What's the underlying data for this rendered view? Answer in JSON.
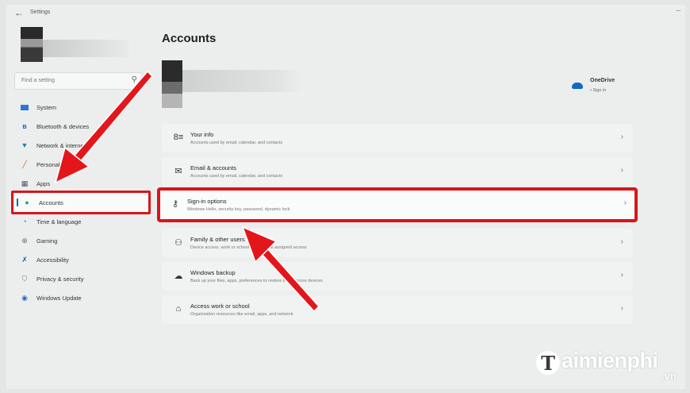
{
  "window": {
    "title": "Settings"
  },
  "sidebar": {
    "search_placeholder": "Find a setting",
    "items": [
      {
        "label": "System",
        "icon": "monitor-icon",
        "color": "#2b78d5"
      },
      {
        "label": "Bluetooth & devices",
        "icon": "bluetooth-icon",
        "color": "#1d6fcb"
      },
      {
        "label": "Network & internet",
        "icon": "wifi-icon",
        "color": "#1d7fb5"
      },
      {
        "label": "Personalization",
        "icon": "brush-icon",
        "color": "#c56a2d"
      },
      {
        "label": "Apps",
        "icon": "apps-icon",
        "color": "#4a5670"
      },
      {
        "label": "Accounts",
        "icon": "person-icon",
        "color": "#2ea66a",
        "active": true
      },
      {
        "label": "Time & language",
        "icon": "globe-clock-icon",
        "color": "#2e7cc4"
      },
      {
        "label": "Gaming",
        "icon": "gamepad-icon",
        "color": "#6d6d6d"
      },
      {
        "label": "Accessibility",
        "icon": "accessibility-icon",
        "color": "#1e5fab"
      },
      {
        "label": "Privacy & security",
        "icon": "shield-icon",
        "color": "#7b7b7b"
      },
      {
        "label": "Windows Update",
        "icon": "update-icon",
        "color": "#1f6fc3"
      }
    ]
  },
  "main": {
    "title": "Accounts",
    "onedrive": {
      "title": "OneDrive",
      "subtitle": "• Sign in"
    },
    "cards": [
      {
        "title": "Your info",
        "subtitle": "Accounts used by email, calendar, and contacts",
        "icon": "person-list-icon"
      },
      {
        "title": "Email & accounts",
        "subtitle": "Accounts used by email, calendar, and contacts",
        "icon": "mail-icon"
      },
      {
        "title": "Sign-in options",
        "subtitle": "Windows Hello, security key, password, dynamic lock",
        "icon": "key-icon",
        "highlighted": true
      },
      {
        "title": "Family & other users",
        "subtitle": "Device access, work or school users, kiosk assigned access",
        "icon": "family-icon"
      },
      {
        "title": "Windows backup",
        "subtitle": "Back up your files, apps, preferences to restore them across devices",
        "icon": "backup-icon"
      },
      {
        "title": "Access work or school",
        "subtitle": "Organization resources like email, apps, and network",
        "icon": "briefcase-icon"
      }
    ]
  },
  "watermark": {
    "brand": "aimienphi",
    "initial": "T",
    "tld": ".vn"
  },
  "colors": {
    "highlight": "#d9151b",
    "accent": "#0067c0"
  }
}
